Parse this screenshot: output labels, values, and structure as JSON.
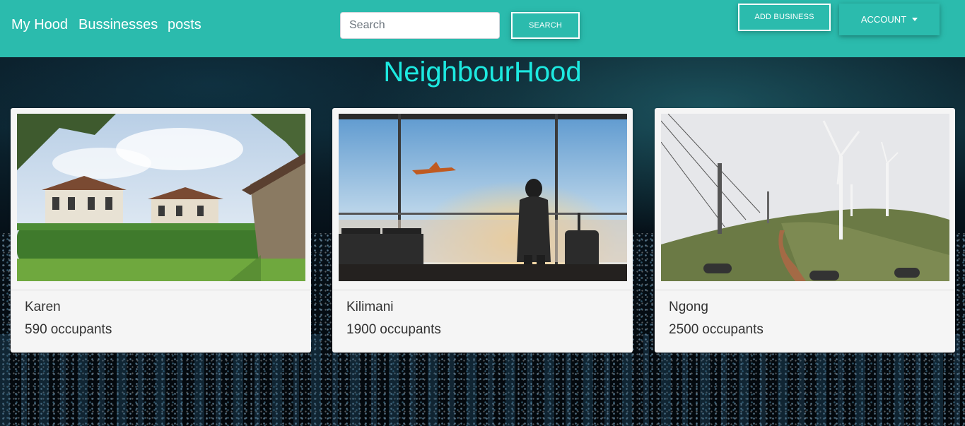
{
  "nav": {
    "brand": "My Hood",
    "links": [
      "Bussinesses",
      "posts"
    ],
    "search": {
      "placeholder": "Search",
      "value": ""
    },
    "search_button": "SEARCH",
    "add_business_button": "ADD BUSINESS",
    "account_button": "ACCOUNT"
  },
  "page_title": "NeighbourHood",
  "hoods": [
    {
      "name": "Karen",
      "occupants": "590",
      "occupants_label": "occupants",
      "image": "suburban houses with hedge and lawn"
    },
    {
      "name": "Kilimani",
      "occupants": "1900",
      "occupants_label": "occupants",
      "image": "traveler with luggage at airport window, plane in sky"
    },
    {
      "name": "Ngong",
      "occupants": "2500",
      "occupants_label": "occupants",
      "image": "wind turbines on a hill"
    }
  ],
  "colors": {
    "navbar": "#2bbbad",
    "title": "#1de9e0",
    "card": "#f5f5f5"
  }
}
